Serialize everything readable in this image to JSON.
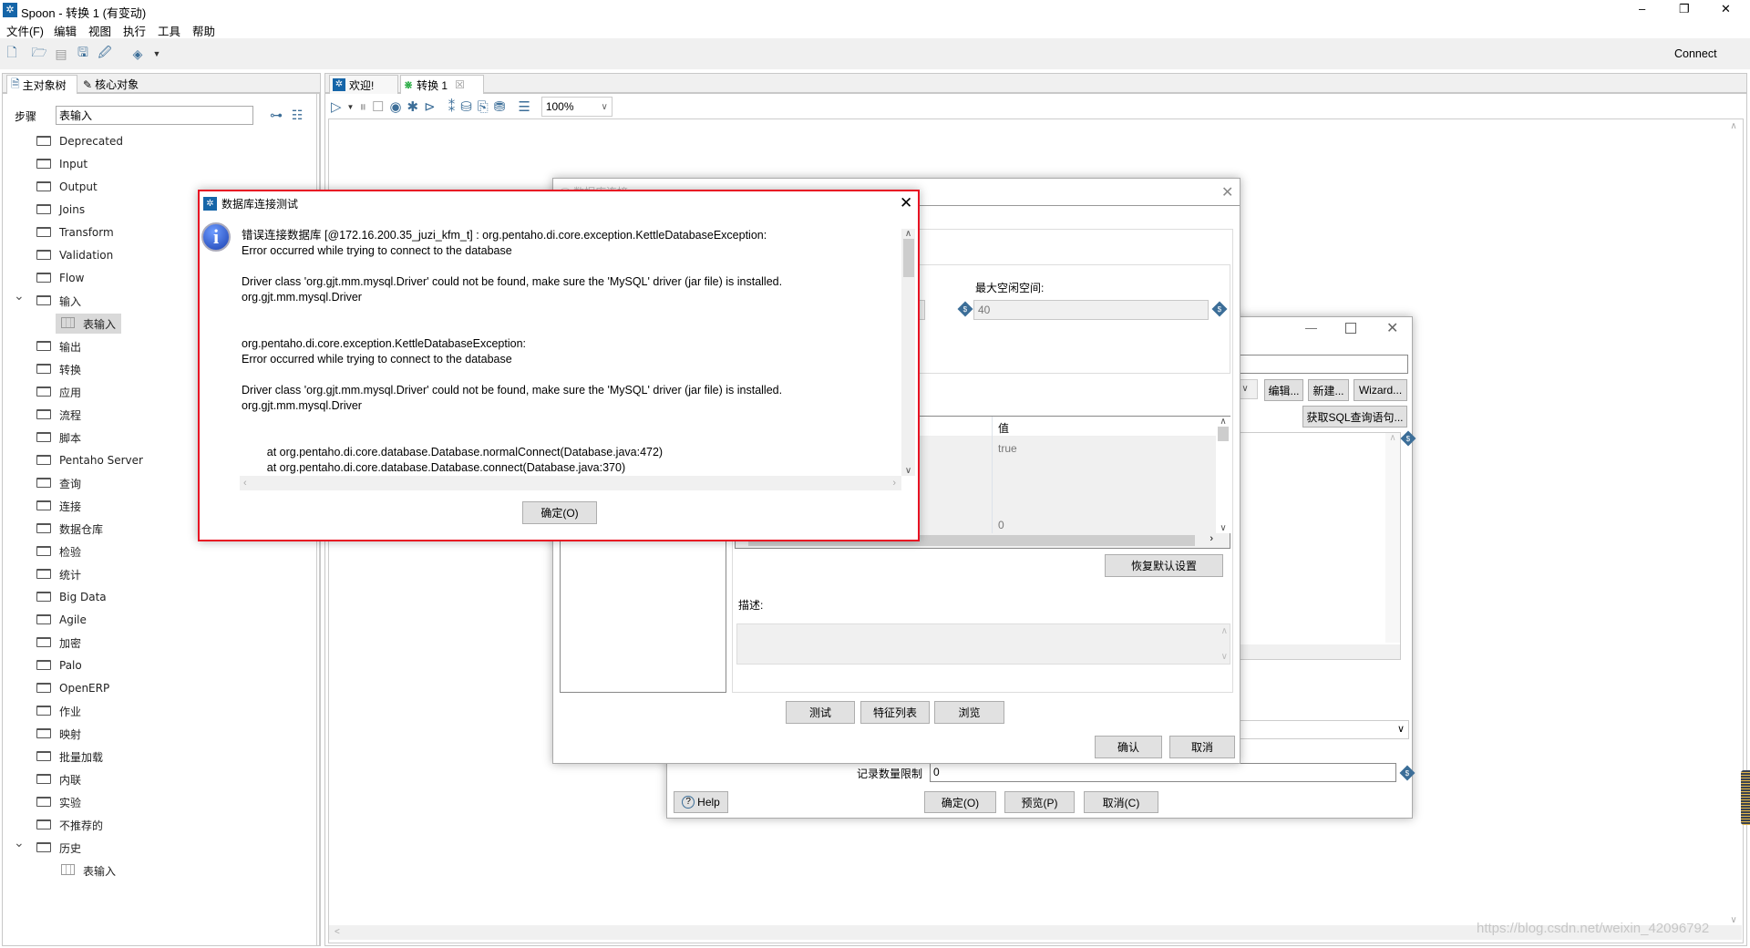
{
  "window": {
    "title": "Spoon - 转换 1 (有变动)",
    "minimize": "–",
    "restore": "❐",
    "close": "✕"
  },
  "menu": [
    "文件(F)",
    "编辑",
    "视图",
    "执行",
    "工具",
    "帮助"
  ],
  "toolbar": {
    "connect": "Connect",
    "icons": [
      "new-file-icon",
      "open-icon",
      "explore-icon",
      "save-icon",
      "save-as-icon",
      "layers-icon"
    ]
  },
  "left_panel": {
    "tabs": [
      "主对象树",
      "核心对象"
    ],
    "steps_label": "步骤",
    "search_value": "表输入",
    "tree": [
      {
        "label": "Deprecated"
      },
      {
        "label": "Input"
      },
      {
        "label": "Output"
      },
      {
        "label": "Joins"
      },
      {
        "label": "Transform"
      },
      {
        "label": "Validation"
      },
      {
        "label": "Flow"
      },
      {
        "label": "输入",
        "expanded": true
      },
      {
        "label": "表输入",
        "child": true,
        "selected": true
      },
      {
        "label": "输出"
      },
      {
        "label": "转换"
      },
      {
        "label": "应用"
      },
      {
        "label": "流程"
      },
      {
        "label": "脚本"
      },
      {
        "label": "Pentaho Server"
      },
      {
        "label": "查询"
      },
      {
        "label": "连接"
      },
      {
        "label": "数据仓库"
      },
      {
        "label": "检验"
      },
      {
        "label": "统计"
      },
      {
        "label": "Big Data"
      },
      {
        "label": "Agile"
      },
      {
        "label": "加密"
      },
      {
        "label": "Palo"
      },
      {
        "label": "OpenERP"
      },
      {
        "label": "作业"
      },
      {
        "label": "映射"
      },
      {
        "label": "批量加载"
      },
      {
        "label": "内联"
      },
      {
        "label": "实验"
      },
      {
        "label": "不推荐的"
      },
      {
        "label": "历史",
        "expanded": true
      },
      {
        "label": "表输入",
        "child": true
      }
    ]
  },
  "editor": {
    "tabs": [
      {
        "label": "欢迎!"
      },
      {
        "label": "转换 1",
        "close": "☒"
      }
    ],
    "zoom": "100%"
  },
  "step_dialog": {
    "buttons_row": [
      "编辑...",
      "新建...",
      "Wizard..."
    ],
    "get_sql": "获取SQL查询语句...",
    "limit_label": "记录数量限制",
    "limit_value": "0",
    "help": "Help",
    "ok": "确定(O)",
    "preview": "预览(P)",
    "cancel": "取消(C)"
  },
  "db_dialog": {
    "title": "数据库连接",
    "max_idle_label": "最大空闲空间:",
    "max_idle_value": "40",
    "table_header": "值",
    "table_values": [
      "true",
      "0"
    ],
    "restore_defaults": "恢复默认设置",
    "description_label": "描述:",
    "test": "测试",
    "features": "特征列表",
    "explore": "浏览",
    "confirm": "确认",
    "cancel": "取消"
  },
  "error_dialog": {
    "title": "数据库连接测试",
    "lines": [
      "错误连接数据库 [@172.16.200.35_juzi_kfm_t] : org.pentaho.di.core.exception.KettleDatabaseException:",
      "Error occurred while trying to connect to the database",
      "",
      "Driver class 'org.gjt.mm.mysql.Driver' could not be found, make sure the 'MySQL' driver (jar file) is installed.",
      "org.gjt.mm.mysql.Driver",
      "",
      "",
      "org.pentaho.di.core.exception.KettleDatabaseException:",
      "Error occurred while trying to connect to the database",
      "",
      "Driver class 'org.gjt.mm.mysql.Driver' could not be found, make sure the 'MySQL' driver (jar file) is installed.",
      "org.gjt.mm.mysql.Driver",
      "",
      "",
      "\tat org.pentaho.di.core.database.Database.normalConnect(Database.java:472)",
      "\tat org.pentaho.di.core.database.Database.connect(Database.java:370)"
    ],
    "ok": "确定(O)",
    "accent": "#e81123"
  },
  "watermark": "https://blog.csdn.net/weixin_42096792"
}
